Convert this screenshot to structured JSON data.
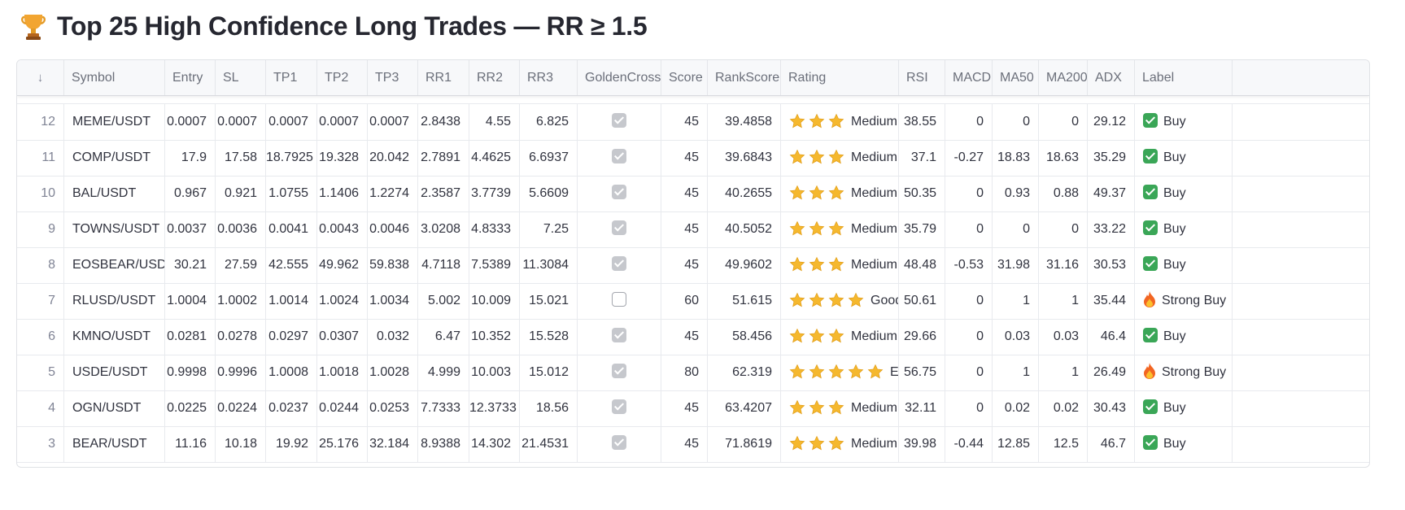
{
  "page": {
    "title": "Top 25 High Confidence Long Trades — RR ≥ 1.5",
    "title_icon": "trophy-icon"
  },
  "table": {
    "sort_indicator": "↓",
    "columns": [
      "Symbol",
      "Entry",
      "SL",
      "TP1",
      "TP2",
      "TP3",
      "RR1",
      "RR2",
      "RR3",
      "GoldenCross",
      "Score",
      "RankScore",
      "Rating",
      "RSI",
      "MACD",
      "MA50",
      "MA200",
      "ADX",
      "Label"
    ],
    "rows": [
      {
        "idx": "12",
        "symbol": "MEME/USDT",
        "entry": "0.0007",
        "sl": "0.0007",
        "tp1": "0.0007",
        "tp2": "0.0007",
        "tp3": "0.0007",
        "rr1": "2.8438",
        "rr2": "4.55",
        "rr3": "6.825",
        "golden_cross": true,
        "score": "45",
        "rank_score": "39.4858",
        "stars": 3,
        "rating": "Medium",
        "rsi": "38.55",
        "macd": "0",
        "ma50": "0",
        "ma200": "0",
        "adx": "29.12",
        "label": "Buy",
        "label_icon": "check-icon"
      },
      {
        "idx": "11",
        "symbol": "COMP/USDT",
        "entry": "17.9",
        "sl": "17.58",
        "tp1": "18.7925",
        "tp2": "19.328",
        "tp3": "20.042",
        "rr1": "2.7891",
        "rr2": "4.4625",
        "rr3": "6.6937",
        "golden_cross": true,
        "score": "45",
        "rank_score": "39.6843",
        "stars": 3,
        "rating": "Medium",
        "rsi": "37.1",
        "macd": "-0.27",
        "ma50": "18.83",
        "ma200": "18.63",
        "adx": "35.29",
        "label": "Buy",
        "label_icon": "check-icon"
      },
      {
        "idx": "10",
        "symbol": "BAL/USDT",
        "entry": "0.967",
        "sl": "0.921",
        "tp1": "1.0755",
        "tp2": "1.1406",
        "tp3": "1.2274",
        "rr1": "2.3587",
        "rr2": "3.7739",
        "rr3": "5.6609",
        "golden_cross": true,
        "score": "45",
        "rank_score": "40.2655",
        "stars": 3,
        "rating": "Medium",
        "rsi": "50.35",
        "macd": "0",
        "ma50": "0.93",
        "ma200": "0.88",
        "adx": "49.37",
        "label": "Buy",
        "label_icon": "check-icon"
      },
      {
        "idx": "9",
        "symbol": "TOWNS/USDT",
        "entry": "0.0037",
        "sl": "0.0036",
        "tp1": "0.0041",
        "tp2": "0.0043",
        "tp3": "0.0046",
        "rr1": "3.0208",
        "rr2": "4.8333",
        "rr3": "7.25",
        "golden_cross": true,
        "score": "45",
        "rank_score": "40.5052",
        "stars": 3,
        "rating": "Medium",
        "rsi": "35.79",
        "macd": "0",
        "ma50": "0",
        "ma200": "0",
        "adx": "33.22",
        "label": "Buy",
        "label_icon": "check-icon"
      },
      {
        "idx": "8",
        "symbol": "EOSBEAR/USDT",
        "entry": "30.21",
        "sl": "27.59",
        "tp1": "42.555",
        "tp2": "49.962",
        "tp3": "59.838",
        "rr1": "4.7118",
        "rr2": "7.5389",
        "rr3": "11.3084",
        "golden_cross": true,
        "score": "45",
        "rank_score": "49.9602",
        "stars": 3,
        "rating": "Medium",
        "rsi": "48.48",
        "macd": "-0.53",
        "ma50": "31.98",
        "ma200": "31.16",
        "adx": "30.53",
        "label": "Buy",
        "label_icon": "check-icon"
      },
      {
        "idx": "7",
        "symbol": "RLUSD/USDT",
        "entry": "1.0004",
        "sl": "1.0002",
        "tp1": "1.0014",
        "tp2": "1.0024",
        "tp3": "1.0034",
        "rr1": "5.002",
        "rr2": "10.009",
        "rr3": "15.021",
        "golden_cross": false,
        "score": "60",
        "rank_score": "51.615",
        "stars": 4,
        "rating": "Good",
        "rsi": "50.61",
        "macd": "0",
        "ma50": "1",
        "ma200": "1",
        "adx": "35.44",
        "label": "Strong Buy",
        "label_icon": "fire-icon"
      },
      {
        "idx": "6",
        "symbol": "KMNO/USDT",
        "entry": "0.0281",
        "sl": "0.0278",
        "tp1": "0.0297",
        "tp2": "0.0307",
        "tp3": "0.032",
        "rr1": "6.47",
        "rr2": "10.352",
        "rr3": "15.528",
        "golden_cross": true,
        "score": "45",
        "rank_score": "58.456",
        "stars": 3,
        "rating": "Medium",
        "rsi": "29.66",
        "macd": "0",
        "ma50": "0.03",
        "ma200": "0.03",
        "adx": "46.4",
        "label": "Buy",
        "label_icon": "check-icon"
      },
      {
        "idx": "5",
        "symbol": "USDE/USDT",
        "entry": "0.9998",
        "sl": "0.9996",
        "tp1": "1.0008",
        "tp2": "1.0018",
        "tp3": "1.0028",
        "rr1": "4.999",
        "rr2": "10.003",
        "rr3": "15.012",
        "golden_cross": true,
        "score": "80",
        "rank_score": "62.319",
        "stars": 5,
        "rating": "Exce",
        "rsi": "56.75",
        "macd": "0",
        "ma50": "1",
        "ma200": "1",
        "adx": "26.49",
        "label": "Strong Buy",
        "label_icon": "fire-icon"
      },
      {
        "idx": "4",
        "symbol": "OGN/USDT",
        "entry": "0.0225",
        "sl": "0.0224",
        "tp1": "0.0237",
        "tp2": "0.0244",
        "tp3": "0.0253",
        "rr1": "7.7333",
        "rr2": "12.3733",
        "rr3": "18.56",
        "golden_cross": true,
        "score": "45",
        "rank_score": "63.4207",
        "stars": 3,
        "rating": "Medium",
        "rsi": "32.11",
        "macd": "0",
        "ma50": "0.02",
        "ma200": "0.02",
        "adx": "30.43",
        "label": "Buy",
        "label_icon": "check-icon"
      },
      {
        "idx": "3",
        "symbol": "BEAR/USDT",
        "entry": "11.16",
        "sl": "10.18",
        "tp1": "19.92",
        "tp2": "25.176",
        "tp3": "32.184",
        "rr1": "8.9388",
        "rr2": "14.302",
        "rr3": "21.4531",
        "golden_cross": true,
        "score": "45",
        "rank_score": "71.8619",
        "stars": 3,
        "rating": "Medium",
        "rsi": "39.98",
        "macd": "-0.44",
        "ma50": "12.85",
        "ma200": "12.5",
        "adx": "46.7",
        "label": "Buy",
        "label_icon": "check-icon"
      }
    ]
  },
  "colors": {
    "header_bg": "#f7f8fa",
    "grid_line": "#e8eaee",
    "star": "#f5b82e",
    "buy_check": "#3aa657",
    "fire": "#f26522"
  }
}
